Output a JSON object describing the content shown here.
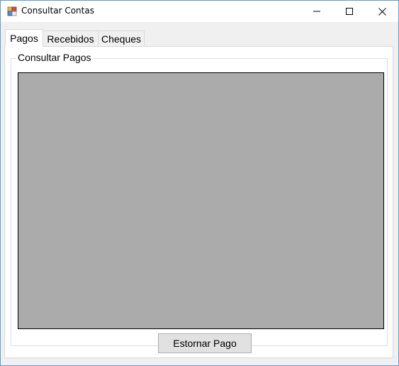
{
  "window": {
    "title": "Consultar Contas",
    "icon": "windows-forms-app-icon",
    "controls": {
      "minimize": "minimize-icon",
      "maximize": "maximize-icon",
      "close": "close-icon"
    }
  },
  "tabs": [
    {
      "label": "Pagos",
      "selected": true
    },
    {
      "label": "Recebidos",
      "selected": false
    },
    {
      "label": "Cheques",
      "selected": false
    }
  ],
  "group": {
    "title": "Consultar Pagos"
  },
  "actions": {
    "reverse_label": "Estornar Pago"
  },
  "colors": {
    "window_border": "#5c9fd6",
    "grid_background": "#ababab",
    "button_background": "#e1e1e1"
  }
}
